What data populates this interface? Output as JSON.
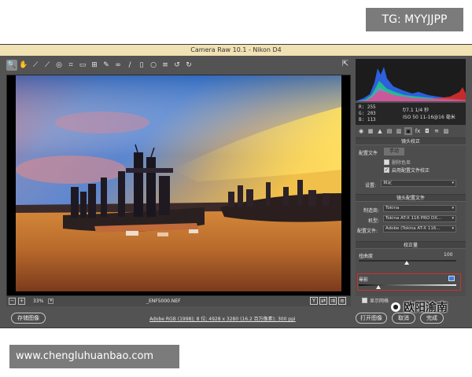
{
  "badges": {
    "tg": "TG: MYYJJPP",
    "url": "www.chengluhuanbao.com"
  },
  "window": {
    "title": "Camera Raw 10.1 - Nikon D4"
  },
  "toolbar": {
    "tools": [
      {
        "name": "zoom-tool-icon",
        "glyph": "🔍"
      },
      {
        "name": "hand-tool-icon",
        "glyph": "✋"
      },
      {
        "name": "white-balance-tool-icon",
        "glyph": "⟋"
      },
      {
        "name": "color-sampler-tool-icon",
        "glyph": "⟋"
      },
      {
        "name": "targeted-adjustment-tool-icon",
        "glyph": "◎"
      },
      {
        "name": "crop-tool-icon",
        "glyph": "⌗"
      },
      {
        "name": "straighten-tool-icon",
        "glyph": "▭"
      },
      {
        "name": "transform-tool-icon",
        "glyph": "⊞"
      },
      {
        "name": "spot-removal-tool-icon",
        "glyph": "✎"
      },
      {
        "name": "red-eye-tool-icon",
        "glyph": "∞"
      },
      {
        "name": "adjustment-brush-icon",
        "glyph": "/"
      },
      {
        "name": "graduated-filter-icon",
        "glyph": "▯"
      },
      {
        "name": "radial-filter-icon",
        "glyph": "○"
      },
      {
        "name": "preferences-icon",
        "glyph": "≡"
      },
      {
        "name": "rotate-ccw-icon",
        "glyph": "↺"
      },
      {
        "name": "rotate-cw-icon",
        "glyph": "↻"
      }
    ]
  },
  "histogram": {
    "rgb": [
      "R:  255",
      "G:  203",
      "B:  113"
    ],
    "camera": [
      "f/7.1  1/4 秒",
      "ISO 50   11-16@16 毫米"
    ]
  },
  "lens": {
    "section_title": "镜头校正",
    "profile_label": "配置文件",
    "manual_label": "手动",
    "remove_ca": "删除色差",
    "enable_profile": "启用配置文件校正",
    "setup_label": "设置:",
    "setup_value": "自定",
    "lens_profile_title": "镜头配置文件",
    "make_label": "制造商:",
    "make_value": "Tokina",
    "model_label": "机型:",
    "model_value": "Tokina AT-X 116 PRO DX...",
    "profile2_label": "配置文件:",
    "profile2_value": "Adobe (Tokina AT-X 116...",
    "correction_title": "校正量",
    "distortion_label": "扭曲度",
    "distortion_value": "100",
    "vignette_label": "晕影",
    "vignette_value": "",
    "show_grid": "显示网格"
  },
  "statusbar": {
    "zoom": "33%",
    "filename": "_ENF5000.NEF"
  },
  "bottom": {
    "save_label": "存储图像",
    "workflow": "Adobe RGB (1998); 8 位; 4928 x 3280 (16.2 百万像素); 300 ppi",
    "open_label": "打开图像",
    "cancel_label": "取消",
    "done_label": "完成"
  },
  "watermark": {
    "text": "欧阳渝南"
  }
}
